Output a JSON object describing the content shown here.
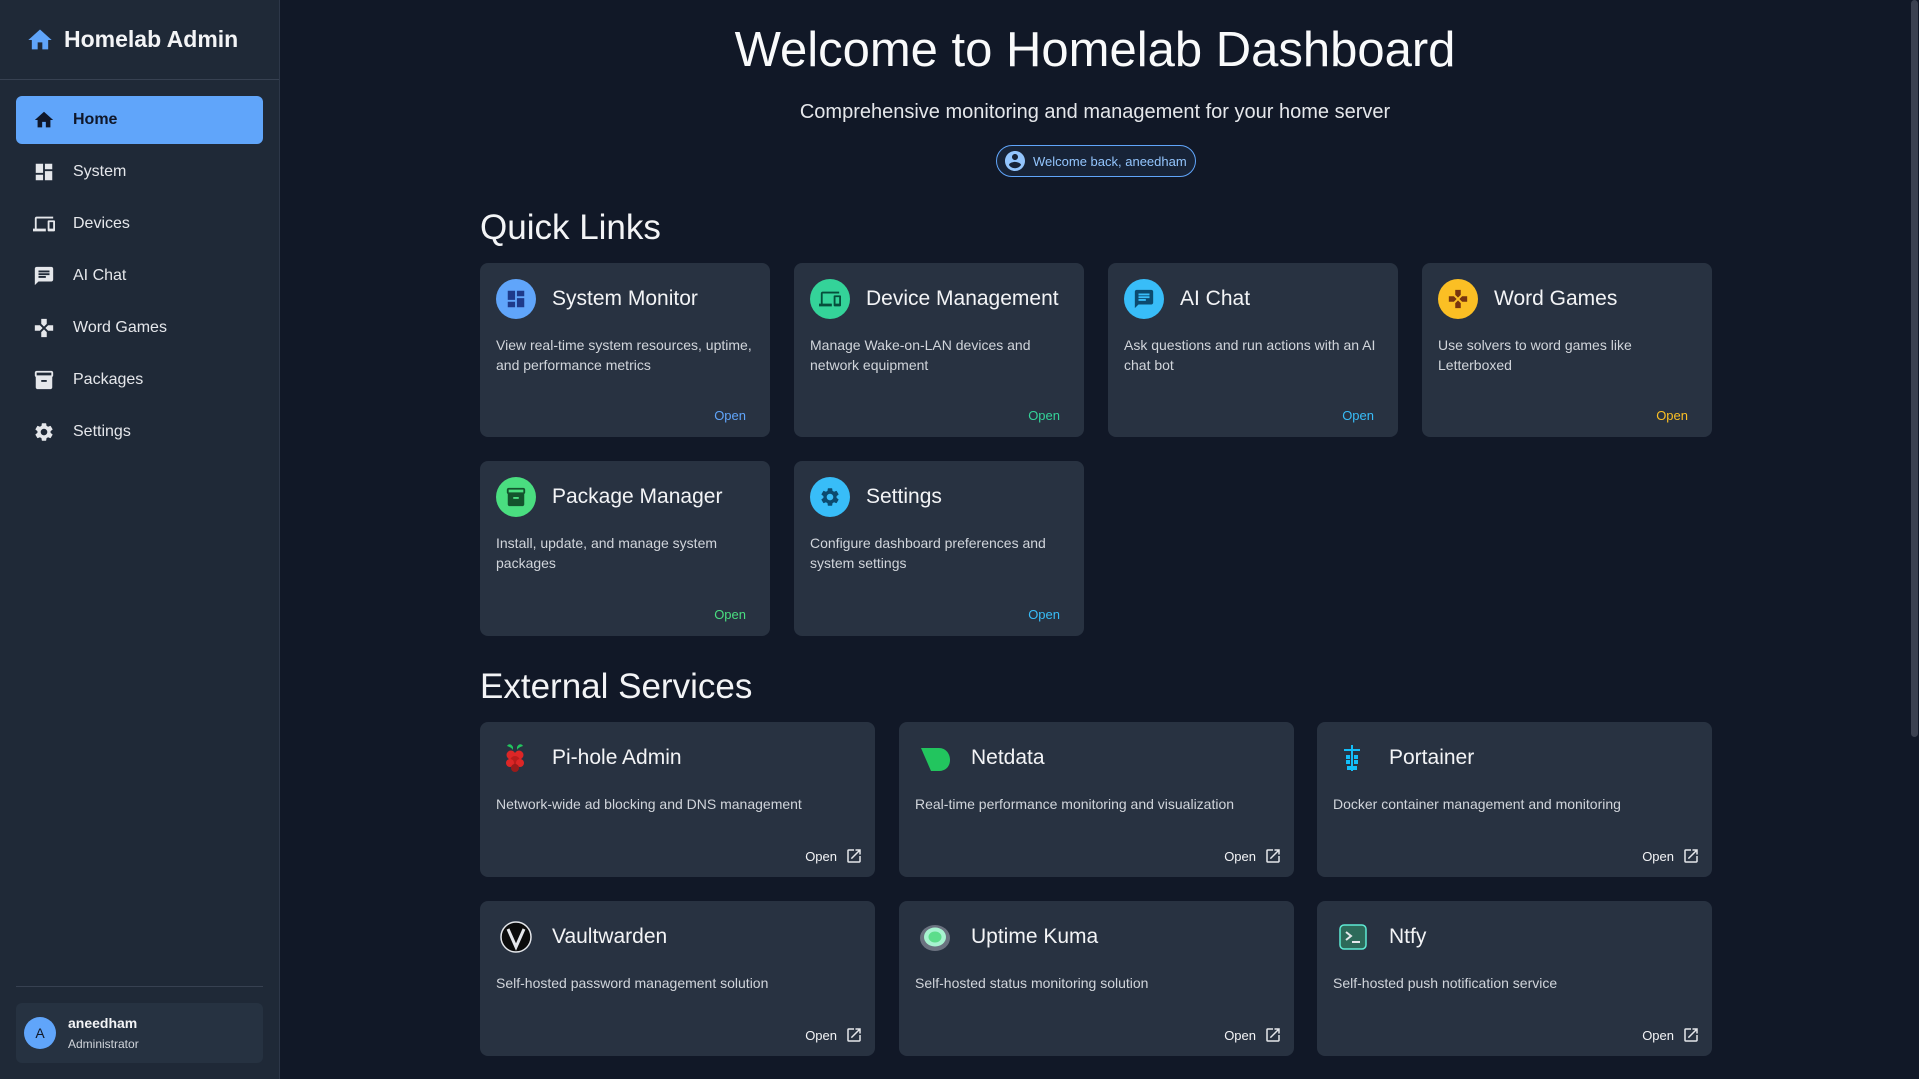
{
  "brand": {
    "title": "Homelab Admin",
    "icon": "home-icon",
    "accent": "#60a5fa"
  },
  "sidebar": {
    "items": [
      {
        "label": "Home",
        "icon": "home-icon",
        "active": true
      },
      {
        "label": "System",
        "icon": "dashboard-icon"
      },
      {
        "label": "Devices",
        "icon": "devices-icon"
      },
      {
        "label": "AI Chat",
        "icon": "chat-icon"
      },
      {
        "label": "Word Games",
        "icon": "gamepad-icon"
      },
      {
        "label": "Packages",
        "icon": "archive-icon"
      },
      {
        "label": "Settings",
        "icon": "gear-icon"
      }
    ],
    "user": {
      "initial": "A",
      "name": "aneedham",
      "role": "Administrator"
    }
  },
  "hero": {
    "title": "Welcome to Homelab Dashboard",
    "subtitle": "Comprehensive monitoring and management for your home server",
    "welcome": "Welcome back, aneedham"
  },
  "quick_links": {
    "title": "Quick Links",
    "cards": [
      {
        "title": "System Monitor",
        "desc": "View real-time system resources, uptime, and performance metrics",
        "open": "Open",
        "icon": "dashboard-icon",
        "color": "#60a5fa"
      },
      {
        "title": "Device Management",
        "desc": "Manage Wake-on-LAN devices and network equipment",
        "open": "Open",
        "icon": "devices-icon",
        "color": "#34d399"
      },
      {
        "title": "AI Chat",
        "desc": "Ask questions and run actions with an AI chat bot",
        "open": "Open",
        "icon": "chat-icon",
        "color": "#38bdf8"
      },
      {
        "title": "Word Games",
        "desc": "Use solvers to word games like Letterboxed",
        "open": "Open",
        "icon": "gamepad-icon",
        "color": "#fbbf24"
      },
      {
        "title": "Package Manager",
        "desc": "Install, update, and manage system packages",
        "open": "Open",
        "icon": "archive-icon",
        "color": "#4ade80"
      },
      {
        "title": "Settings",
        "desc": "Configure dashboard preferences and system settings",
        "open": "Open",
        "icon": "gear-icon",
        "color": "#38bdf8"
      }
    ]
  },
  "external": {
    "title": "External Services",
    "cards": [
      {
        "title": "Pi-hole Admin",
        "desc": "Network-wide ad blocking and DNS management",
        "open": "Open",
        "icon": "raspberry-icon"
      },
      {
        "title": "Netdata",
        "desc": "Real-time performance monitoring and visualization",
        "open": "Open",
        "icon": "netdata-icon"
      },
      {
        "title": "Portainer",
        "desc": "Docker container management and monitoring",
        "open": "Open",
        "icon": "portainer-icon"
      },
      {
        "title": "Vaultwarden",
        "desc": "Self-hosted password management solution",
        "open": "Open",
        "icon": "vaultwarden-icon"
      },
      {
        "title": "Uptime Kuma",
        "desc": "Self-hosted status monitoring solution",
        "open": "Open",
        "icon": "uptime-kuma-icon"
      },
      {
        "title": "Ntfy",
        "desc": "Self-hosted push notification service",
        "open": "Open",
        "icon": "terminal-icon"
      }
    ]
  }
}
